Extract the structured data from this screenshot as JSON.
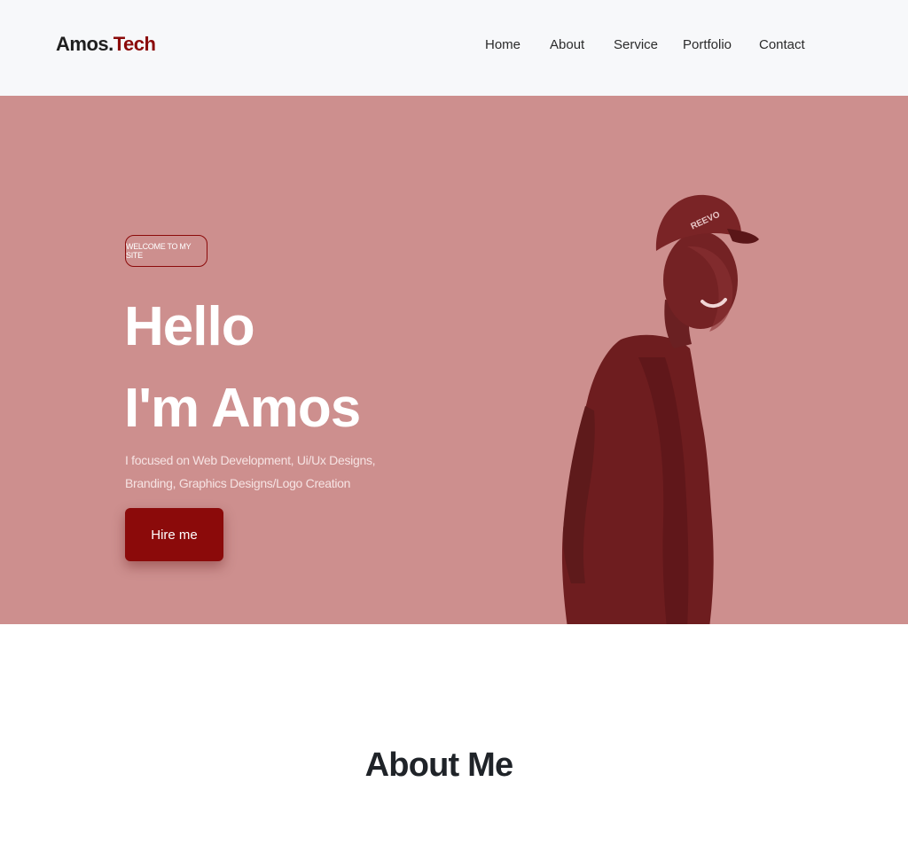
{
  "brand": {
    "name_primary": "Amos.",
    "name_accent": "Tech"
  },
  "nav": {
    "items": [
      {
        "label": "Home"
      },
      {
        "label": "About"
      },
      {
        "label": "Service"
      },
      {
        "label": "Portfolio"
      },
      {
        "label": "Contact"
      }
    ]
  },
  "hero": {
    "badge": "WELCOME TO MY SITE",
    "title_line1": "Hello",
    "title_line2": "I'm Amos",
    "description": "I focused on Web Development, Ui/Ux Designs, Branding, Graphics Designs/Logo Creation",
    "cta_label": "Hire me",
    "cap_text": "REEVO"
  },
  "about": {
    "title": "About Me"
  },
  "colors": {
    "accent": "#8b0a0a",
    "hero_bg": "#cd8f8e",
    "navbar_bg": "#f7f8fa",
    "portrait_tint": "#6e1d1f"
  }
}
